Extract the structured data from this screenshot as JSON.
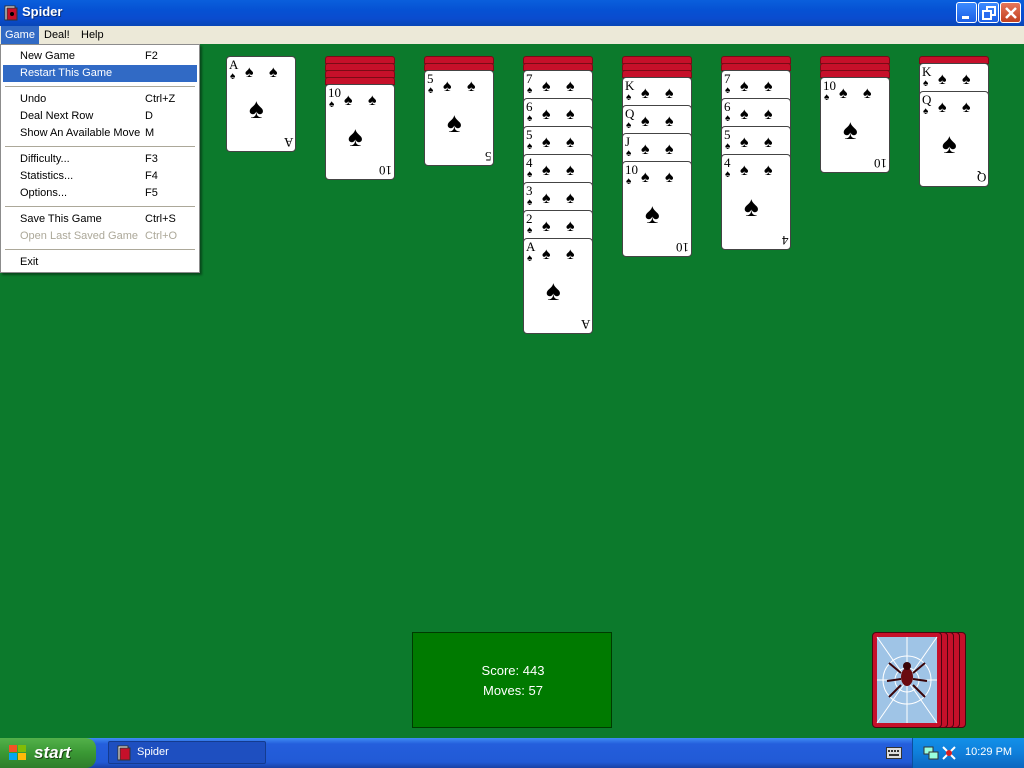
{
  "window": {
    "title": "Spider"
  },
  "menubar": {
    "items": [
      "Game",
      "Deal!",
      "Help"
    ]
  },
  "game_menu": {
    "items": [
      {
        "label": "New Game",
        "shortcut": "F2"
      },
      {
        "label": "Restart This Game",
        "shortcut": ""
      },
      {
        "label": "Undo",
        "shortcut": "Ctrl+Z"
      },
      {
        "label": "Deal Next Row",
        "shortcut": "D"
      },
      {
        "label": "Show An Available Move",
        "shortcut": "M"
      },
      {
        "label": "Difficulty...",
        "shortcut": "F3"
      },
      {
        "label": "Statistics...",
        "shortcut": "F4"
      },
      {
        "label": "Options...",
        "shortcut": "F5"
      },
      {
        "label": "Save This Game",
        "shortcut": "Ctrl+S"
      },
      {
        "label": "Open Last Saved Game",
        "shortcut": "Ctrl+O"
      },
      {
        "label": "Exit",
        "shortcut": ""
      }
    ],
    "highlighted": "Restart This Game",
    "disabled": [
      "Open Last Saved Game"
    ]
  },
  "tableau": [
    {
      "face_down": 0,
      "face_up": [
        "A"
      ]
    },
    {
      "face_down": 4,
      "face_up": [
        "10"
      ]
    },
    {
      "face_down": 2,
      "face_up": [
        "5"
      ]
    },
    {
      "face_down": 2,
      "face_up": [
        "7",
        "6",
        "5",
        "4",
        "3",
        "2",
        "A"
      ]
    },
    {
      "face_down": 3,
      "face_up": [
        "K",
        "Q",
        "J",
        "10"
      ]
    },
    {
      "face_down": 2,
      "face_up": [
        "7",
        "6",
        "5",
        "4"
      ]
    },
    {
      "face_down": 3,
      "face_up": [
        "10"
      ]
    },
    {
      "face_down": 1,
      "face_up": [
        "K",
        "Q"
      ]
    }
  ],
  "suit_symbol": "♠",
  "score": {
    "score_label": "Score:",
    "score_value": "443",
    "moves_label": "Moves:",
    "moves_value": "57"
  },
  "stock": {
    "deals_remaining": 5
  },
  "taskbar": {
    "start_label": "start",
    "task_label": "Spider",
    "clock": "10:29 PM"
  },
  "colors": {
    "felt": "#0c7a2c",
    "card_back": "#c6102a",
    "menu_highlight": "#316ac5"
  }
}
